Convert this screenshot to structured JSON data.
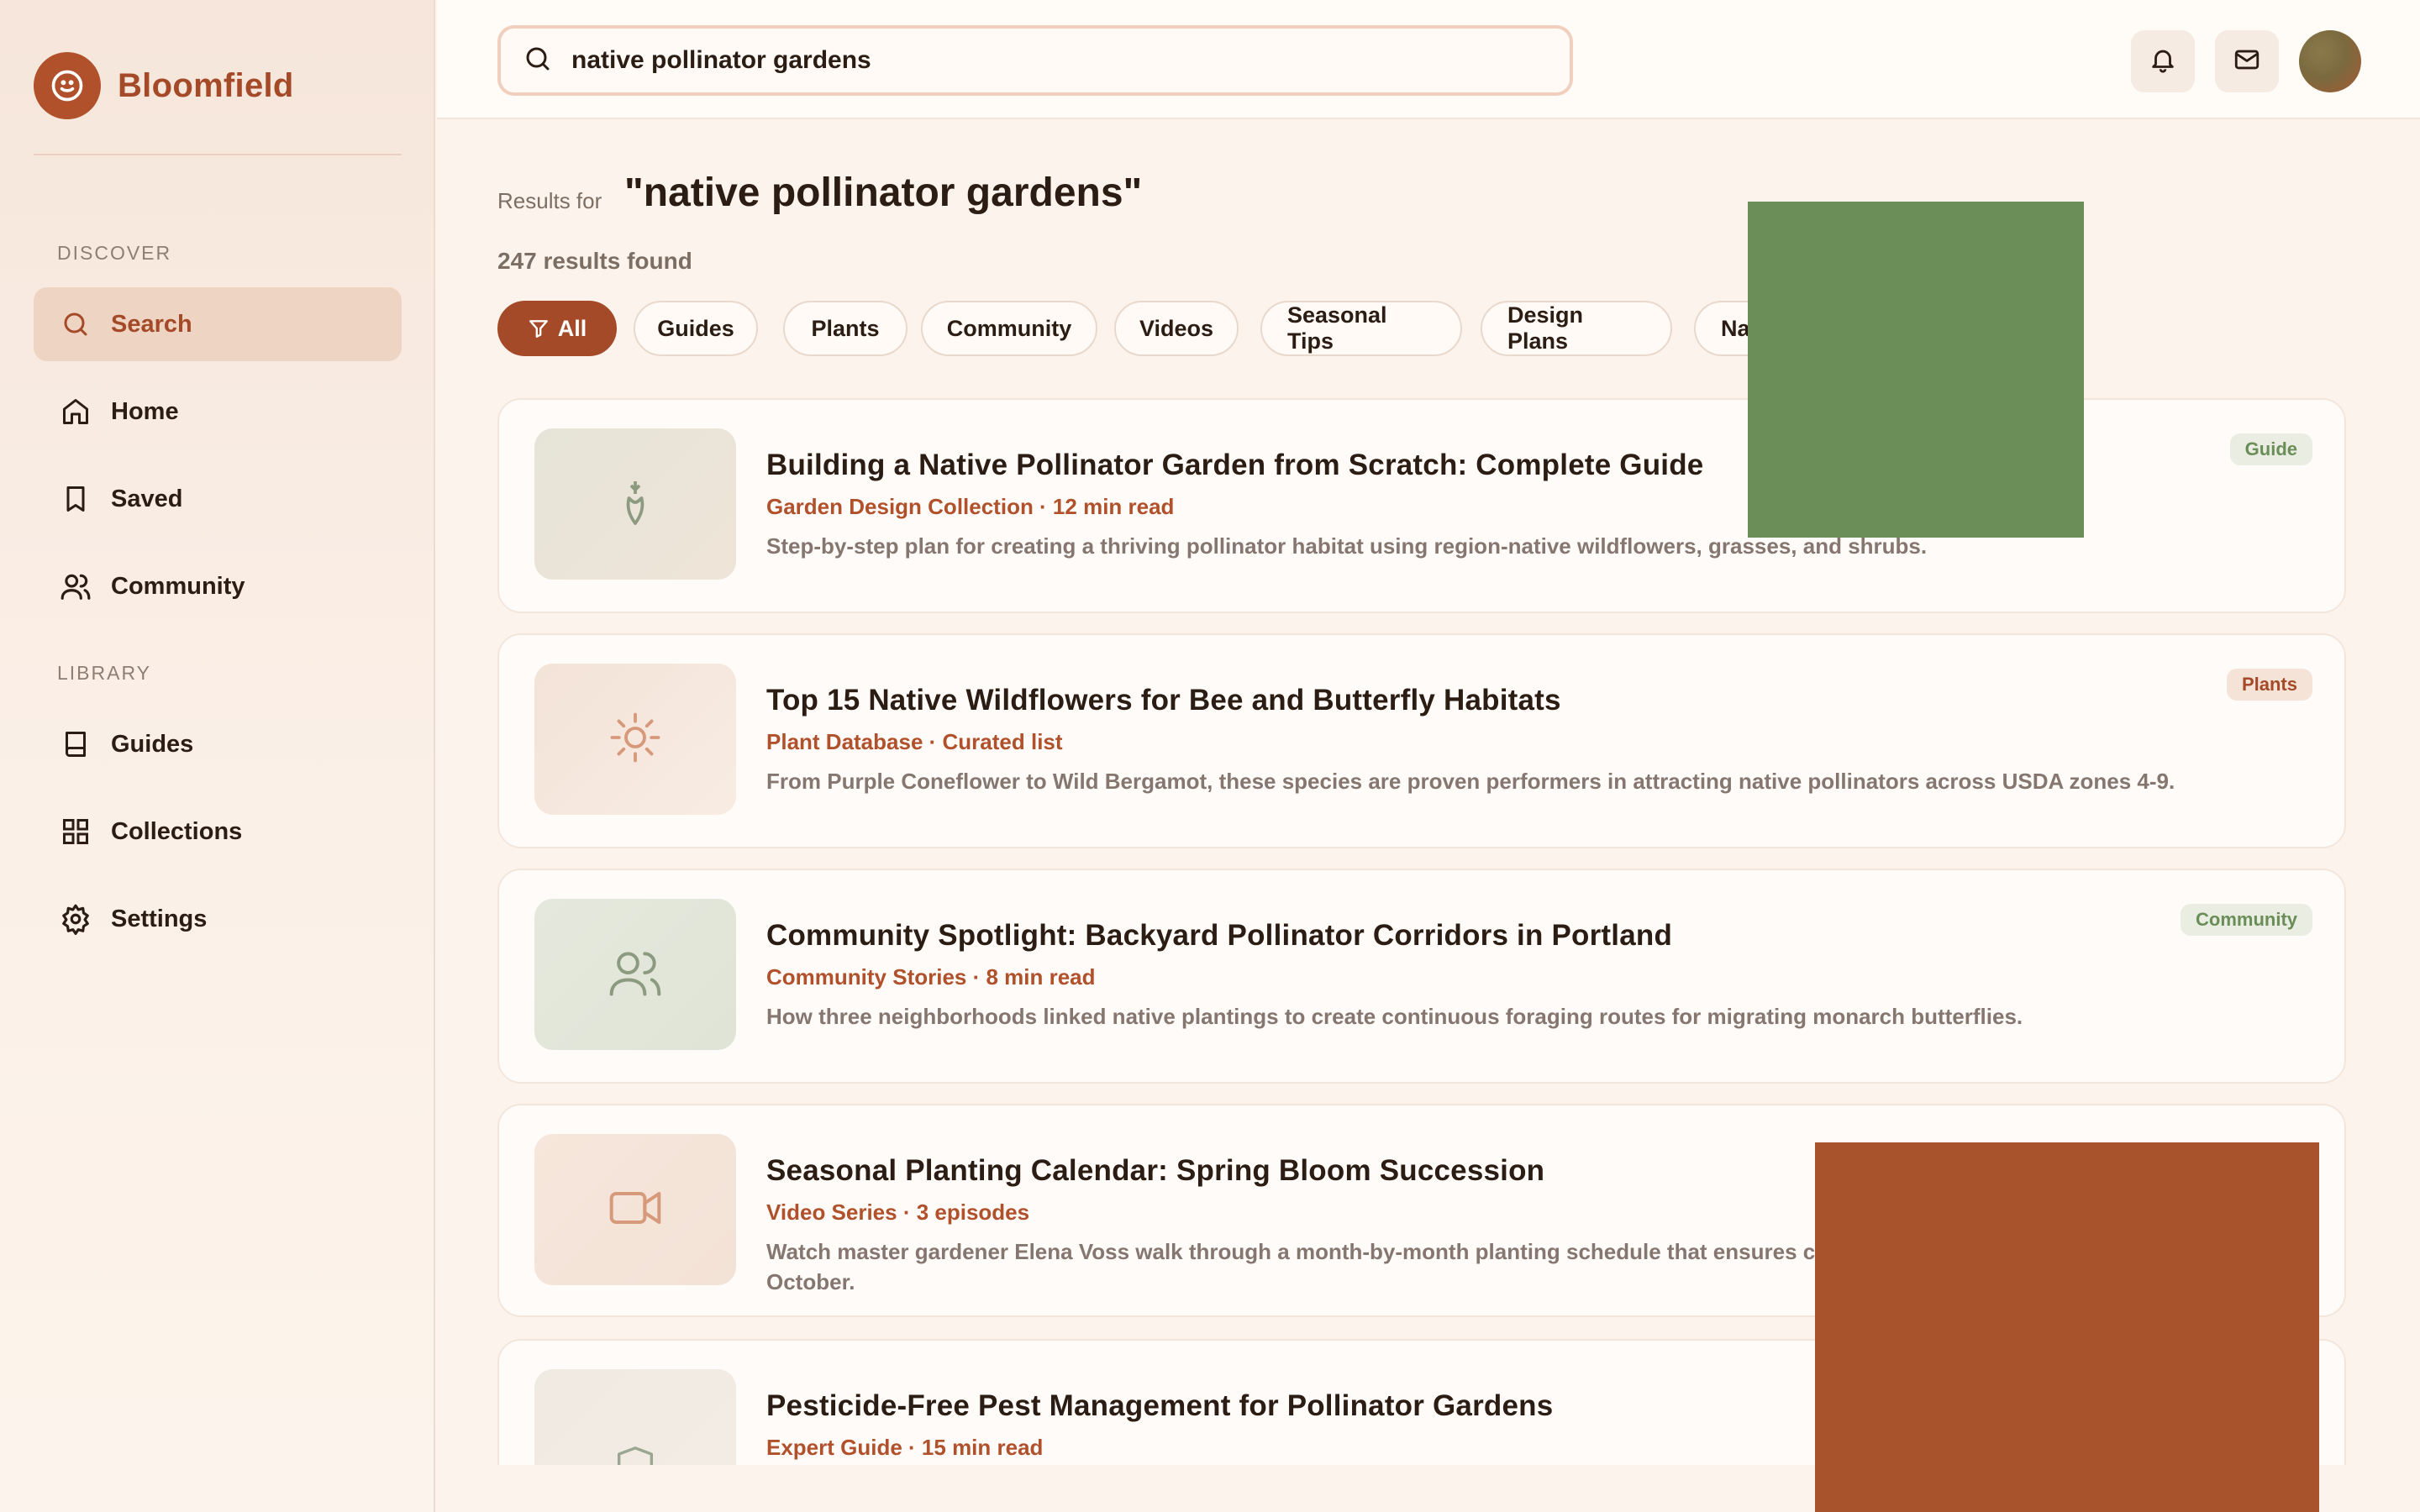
{
  "brand": {
    "name": "Bloomfield",
    "icon": "smiley-logo-icon",
    "color": "#b0512b"
  },
  "sidebar": {
    "sections": [
      {
        "label": "DISCOVER",
        "items": [
          {
            "label": "Search",
            "icon": "search-icon",
            "active": true
          },
          {
            "label": "Home",
            "icon": "home-icon",
            "active": false
          },
          {
            "label": "Saved",
            "icon": "bookmark-icon",
            "active": false
          },
          {
            "label": "Community",
            "icon": "users-icon",
            "active": false
          }
        ]
      },
      {
        "label": "LIBRARY",
        "items": [
          {
            "label": "Guides",
            "icon": "book-icon",
            "active": false
          },
          {
            "label": "Collections",
            "icon": "grid-icon",
            "active": false
          },
          {
            "label": "Settings",
            "icon": "gear-icon",
            "active": false
          }
        ]
      }
    ]
  },
  "header": {
    "search_value": "native pollinator gardens",
    "search_icon": "search-icon",
    "buttons": [
      "bell-icon",
      "mail-icon"
    ],
    "avatar": "user-avatar"
  },
  "results": {
    "results_for_label": "Results for",
    "query": "\"native pollinator gardens\"",
    "count_text": "247 results found",
    "filters": [
      {
        "label": "All",
        "active": true,
        "icon": "filter-icon"
      },
      {
        "label": "Guides",
        "active": false
      },
      {
        "label": "Plants",
        "active": false
      },
      {
        "label": "Community",
        "active": false
      },
      {
        "label": "Videos",
        "active": false
      },
      {
        "label": "Seasonal Tips",
        "active": false
      },
      {
        "label": "Design Plans",
        "active": false
      },
      {
        "label": "Na",
        "active": false
      }
    ],
    "items": [
      {
        "title": "Building a Native Pollinator Garden from Scratch: Complete Guide",
        "meta": "Garden Design Collection · 12 min read",
        "desc": "Step-by-step plan for creating a thriving pollinator habitat using region-native wildflowers, grasses, and shrubs.",
        "badge": "Guide",
        "thumb_icon": "flower-bud-icon"
      },
      {
        "title": "Top 15 Native Wildflowers for Bee and Butterfly Habitats",
        "meta": "Plant Database · Curated list",
        "desc": "From Purple Coneflower to Wild Bergamot, these species are proven performers in attracting native pollinators across USDA zones 4-9.",
        "badge": "Plants",
        "thumb_icon": "sun-icon"
      },
      {
        "title": "Community Spotlight: Backyard Pollinator Corridors in Portland",
        "meta": "Community Stories · 8 min read",
        "desc": "How three neighborhoods linked native plantings to create continuous foraging routes for migrating monarch butterflies.",
        "badge": "Community",
        "thumb_icon": "users-icon"
      },
      {
        "title": "Seasonal Planting Calendar: Spring Bloom Succession",
        "meta": "Video Series · 3 episodes",
        "desc": "Watch master gardener Elena Voss walk through a month-by-month planting schedule that ensures c",
        "desc2": "October.",
        "badge": "",
        "thumb_icon": "video-camera-icon"
      },
      {
        "title": "Pesticide-Free Pest Management for Pollinator Gardens",
        "meta": "Expert Guide · 15 min read",
        "desc": "",
        "badge": "",
        "thumb_icon": "shield-icon"
      }
    ]
  },
  "colors": {
    "accent": "#a54a28",
    "sage": "#6b8e59",
    "rust": "#a8532c"
  }
}
